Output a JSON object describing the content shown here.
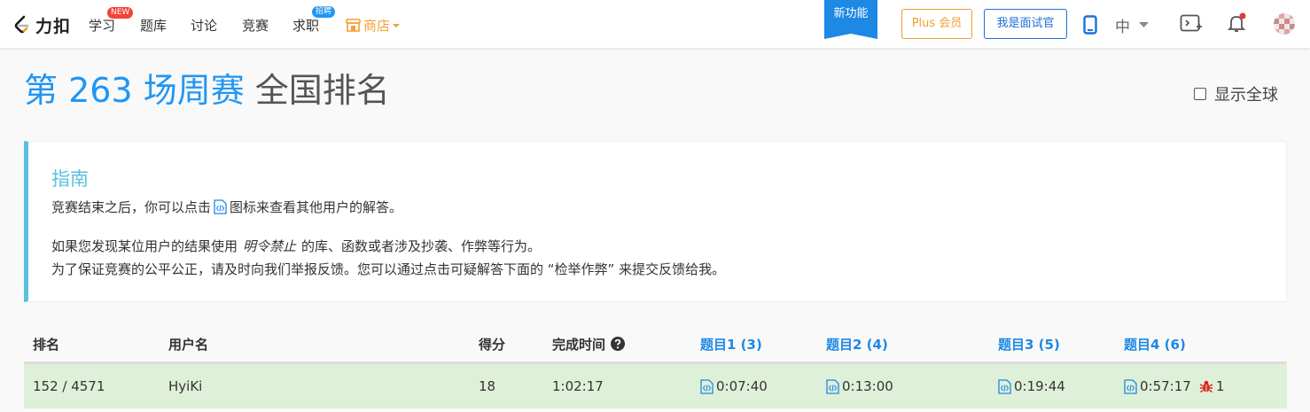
{
  "nav": {
    "logo_text": "力扣",
    "items": [
      {
        "label": "学习",
        "badge": "NEW"
      },
      {
        "label": "题库"
      },
      {
        "label": "讨论"
      },
      {
        "label": "竞赛"
      },
      {
        "label": "求职",
        "badge": "招聘"
      }
    ],
    "store_label": "商店",
    "new_feature": "新功能",
    "plus_label": "Plus 会员",
    "interviewer_label": "我是面试官",
    "lang": "中"
  },
  "title": {
    "blue": "第 263 场周赛",
    "gray": "全国排名"
  },
  "global_toggle": {
    "label": "显示全球",
    "checked": false
  },
  "guide": {
    "title": "指南",
    "line1_a": "竞赛结束之后，你可以点击",
    "line1_b": "图标来查看其他用户的解答。",
    "line2_a": "如果您发现某位用户的结果使用",
    "line2_em": "明令禁止",
    "line2_b": "的库、函数或者涉及抄袭、作弊等行为。",
    "line3": "为了保证竞赛的公平公正，请及时向我们举报反馈。您可以通过点击可疑解答下面的 “检举作弊” 来提交反馈给我。"
  },
  "table": {
    "headers": {
      "rank": "排名",
      "username": "用户名",
      "score": "得分",
      "finish_time": "完成时间",
      "q1": "题目1 (3)",
      "q2": "题目2 (4)",
      "q3": "题目3 (5)",
      "q4": "题目4 (6)"
    },
    "rows": [
      {
        "rank": "152 / 4571",
        "username": "HyiKi",
        "score": "18",
        "finish_time": "1:02:17",
        "q1": "0:07:40",
        "q2": "0:13:00",
        "q3": "0:19:44",
        "q4": "0:57:17",
        "q4_bugs": "1"
      }
    ]
  },
  "colors": {
    "accent": "#2196f3",
    "guide_border": "#5bc0de",
    "row_highlight": "#dff0d8",
    "plus": "#f0a030",
    "bug": "#d9281e"
  }
}
